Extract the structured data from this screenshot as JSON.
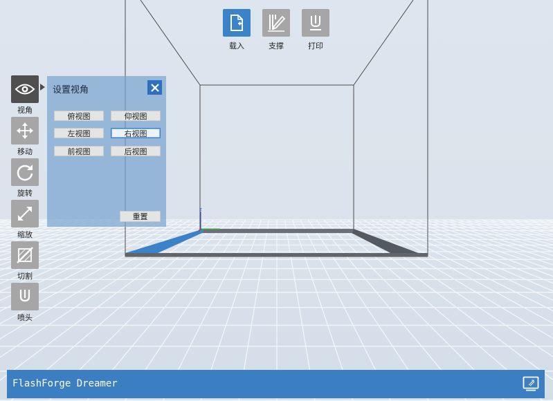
{
  "toolbar": {
    "load_label": "载入",
    "support_label": "支撑",
    "print_label": "打印"
  },
  "sidebar": {
    "items": [
      {
        "label": "视角",
        "icon": "eye-icon",
        "active": true
      },
      {
        "label": "移动",
        "icon": "move-icon",
        "active": false
      },
      {
        "label": "旋转",
        "icon": "rotate-icon",
        "active": false
      },
      {
        "label": "缩放",
        "icon": "scale-icon",
        "active": false
      },
      {
        "label": "切割",
        "icon": "cut-icon",
        "active": false
      },
      {
        "label": "喷头",
        "icon": "nozzle-icon",
        "active": false
      }
    ]
  },
  "view_panel": {
    "title": "设置视角",
    "buttons": {
      "top": "俯视图",
      "bottom": "仰视图",
      "left": "左视图",
      "right": "右视图",
      "front": "前视图",
      "back": "后视图"
    },
    "selected": "right",
    "reset_label": "重置"
  },
  "axis": {
    "z_label": "z"
  },
  "statusbar": {
    "app_name": "FlashForge Dreamer"
  },
  "colors": {
    "accent": "#3b7ec2",
    "toolbar_active": "#3b82c9",
    "toolbar_inactive": "#a6a6a6",
    "panel": "#7aa5d0",
    "background": "#dfe6ee"
  }
}
